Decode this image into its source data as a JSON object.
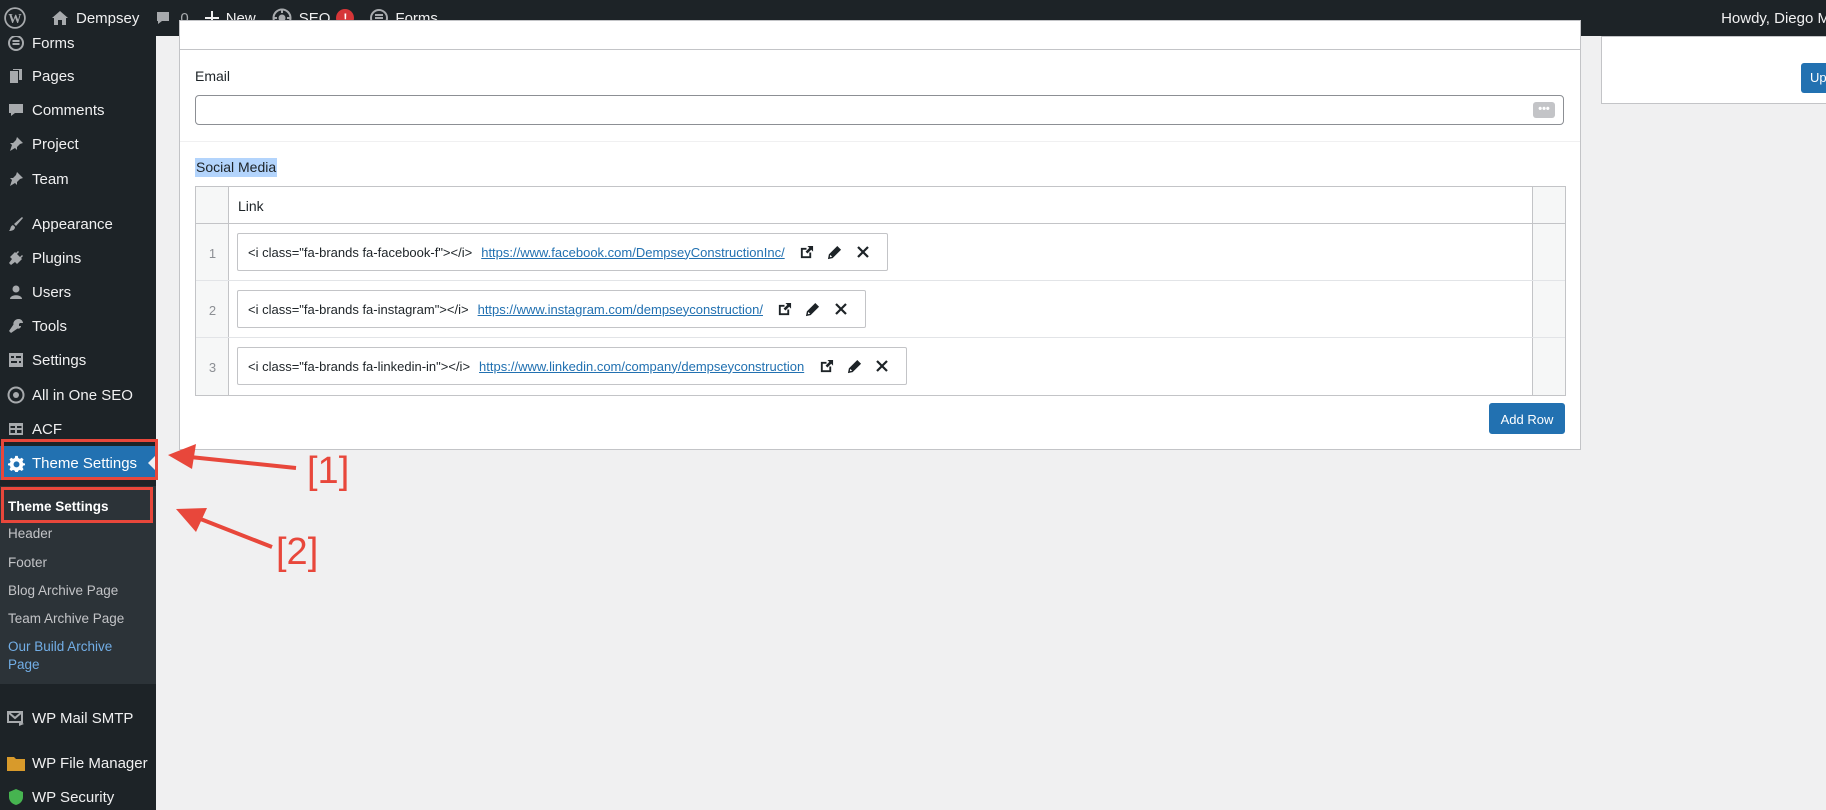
{
  "admin_bar": {
    "site_name": "Dempsey",
    "comments_count": "0",
    "new_label": "New",
    "seo_label": "SEO",
    "seo_badge": "!",
    "forms_label": "Forms",
    "howdy": "Howdy, Diego M"
  },
  "sidebar": {
    "items": [
      {
        "label": "Forms",
        "icon": "forms-icon"
      },
      {
        "label": "Pages",
        "icon": "pages-icon"
      },
      {
        "label": "Comments",
        "icon": "comments-icon"
      },
      {
        "label": "Project",
        "icon": "pin-icon"
      },
      {
        "label": "Team",
        "icon": "pin-icon"
      },
      {
        "label": "Appearance",
        "icon": "paintbrush-icon"
      },
      {
        "label": "Plugins",
        "icon": "plug-icon"
      },
      {
        "label": "Users",
        "icon": "user-icon"
      },
      {
        "label": "Tools",
        "icon": "wrench-icon"
      },
      {
        "label": "Settings",
        "icon": "settings-icon"
      },
      {
        "label": "All in One SEO",
        "icon": "seo-icon"
      },
      {
        "label": "ACF",
        "icon": "grid-icon"
      },
      {
        "label": "Theme Settings",
        "icon": "gear-icon"
      },
      {
        "label": "WP Mail SMTP",
        "icon": "mail-icon"
      },
      {
        "label": "WP File Manager",
        "icon": "folder-icon"
      },
      {
        "label": "WP Security",
        "icon": "shield-icon"
      }
    ],
    "submenu": [
      "Theme Settings",
      "Header",
      "Footer",
      "Blog Archive Page",
      "Team Archive Page",
      "Our Build Archive",
      "Page"
    ]
  },
  "main": {
    "email_label": "Email",
    "email_value": "",
    "social_label": "Social Media",
    "repeater": {
      "column_header": "Link",
      "rows": [
        {
          "num": "1",
          "title": "<i class=\"fa-brands fa-facebook-f\"></i>",
          "url": "https://www.facebook.com/DempseyConstructionInc/"
        },
        {
          "num": "2",
          "title": "<i class=\"fa-brands fa-instagram\"></i>",
          "url": "https://www.instagram.com/dempseyconstruction/"
        },
        {
          "num": "3",
          "title": "<i class=\"fa-brands fa-linkedin-in\"></i>",
          "url": "https://www.linkedin.com/company/dempseyconstruction"
        }
      ]
    },
    "add_row_label": "Add Row",
    "update_label": "Up"
  },
  "annotations": {
    "label_1": "[1]",
    "label_2": "[2]",
    "color": "#e8473b"
  },
  "colors": {
    "admin_dark": "#1d2327",
    "accent": "#2271b1",
    "submenu_bg": "#2c3338",
    "highlight": "#72aee6"
  }
}
